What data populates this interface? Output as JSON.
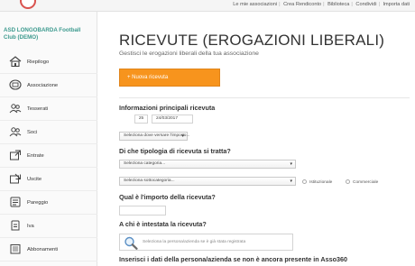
{
  "topbar": {
    "links": [
      "Le mie associazioni",
      "Crea Rendiconto",
      "Biblioteca",
      "Condividi",
      "Importa dati"
    ]
  },
  "sidebar": {
    "club_name": "ASD LONGOBARDA Football Club (DEMO)",
    "items": [
      {
        "label": "Riepilogo",
        "icon": "home-icon"
      },
      {
        "label": "Associazione",
        "icon": "building-icon"
      },
      {
        "label": "Tesserati",
        "icon": "people-icon"
      },
      {
        "label": "Soci",
        "icon": "people-icon"
      },
      {
        "label": "Entrate",
        "icon": "income-icon"
      },
      {
        "label": "Uscite",
        "icon": "expense-icon"
      },
      {
        "label": "Pareggio",
        "icon": "balance-icon"
      },
      {
        "label": "Iva",
        "icon": "tax-icon"
      },
      {
        "label": "Abbonamenti",
        "icon": "subscription-icon"
      }
    ]
  },
  "main": {
    "title": "RICEVUTE (EROGAZIONI LIBERALI)",
    "subtitle": "Gestisci le erogazioni liberali della tua associazione",
    "add_button": "+ Nuova ricevuta",
    "info_section": {
      "heading": "Informazioni principali ricevuta",
      "number": "25",
      "date": "24/03/2017",
      "deposit_select": "Seleziona dove versare l'importo..."
    },
    "type_section": {
      "heading": "Di che tipologia di ricevuta si tratta?",
      "category_select": "Seleziona categoria...",
      "subcategory_select": "Seleziona sottocategoria...",
      "radio_institutional": "Istituzionale",
      "radio_commercial": "Commerciale"
    },
    "amount_section": {
      "heading": "Qual è l'importo della ricevuta?",
      "amount_value": ""
    },
    "recipient_section": {
      "heading": "A chi è intestata la ricevuta?",
      "search_placeholder": "Seleziona la persona/azienda se è già stata registrata"
    },
    "new_person_heading": "Inserisci i dati della persona/azienda se non è ancora presente in Asso360"
  },
  "colors": {
    "accent_orange": "#f7941d",
    "club_teal": "#3c9a8e"
  }
}
